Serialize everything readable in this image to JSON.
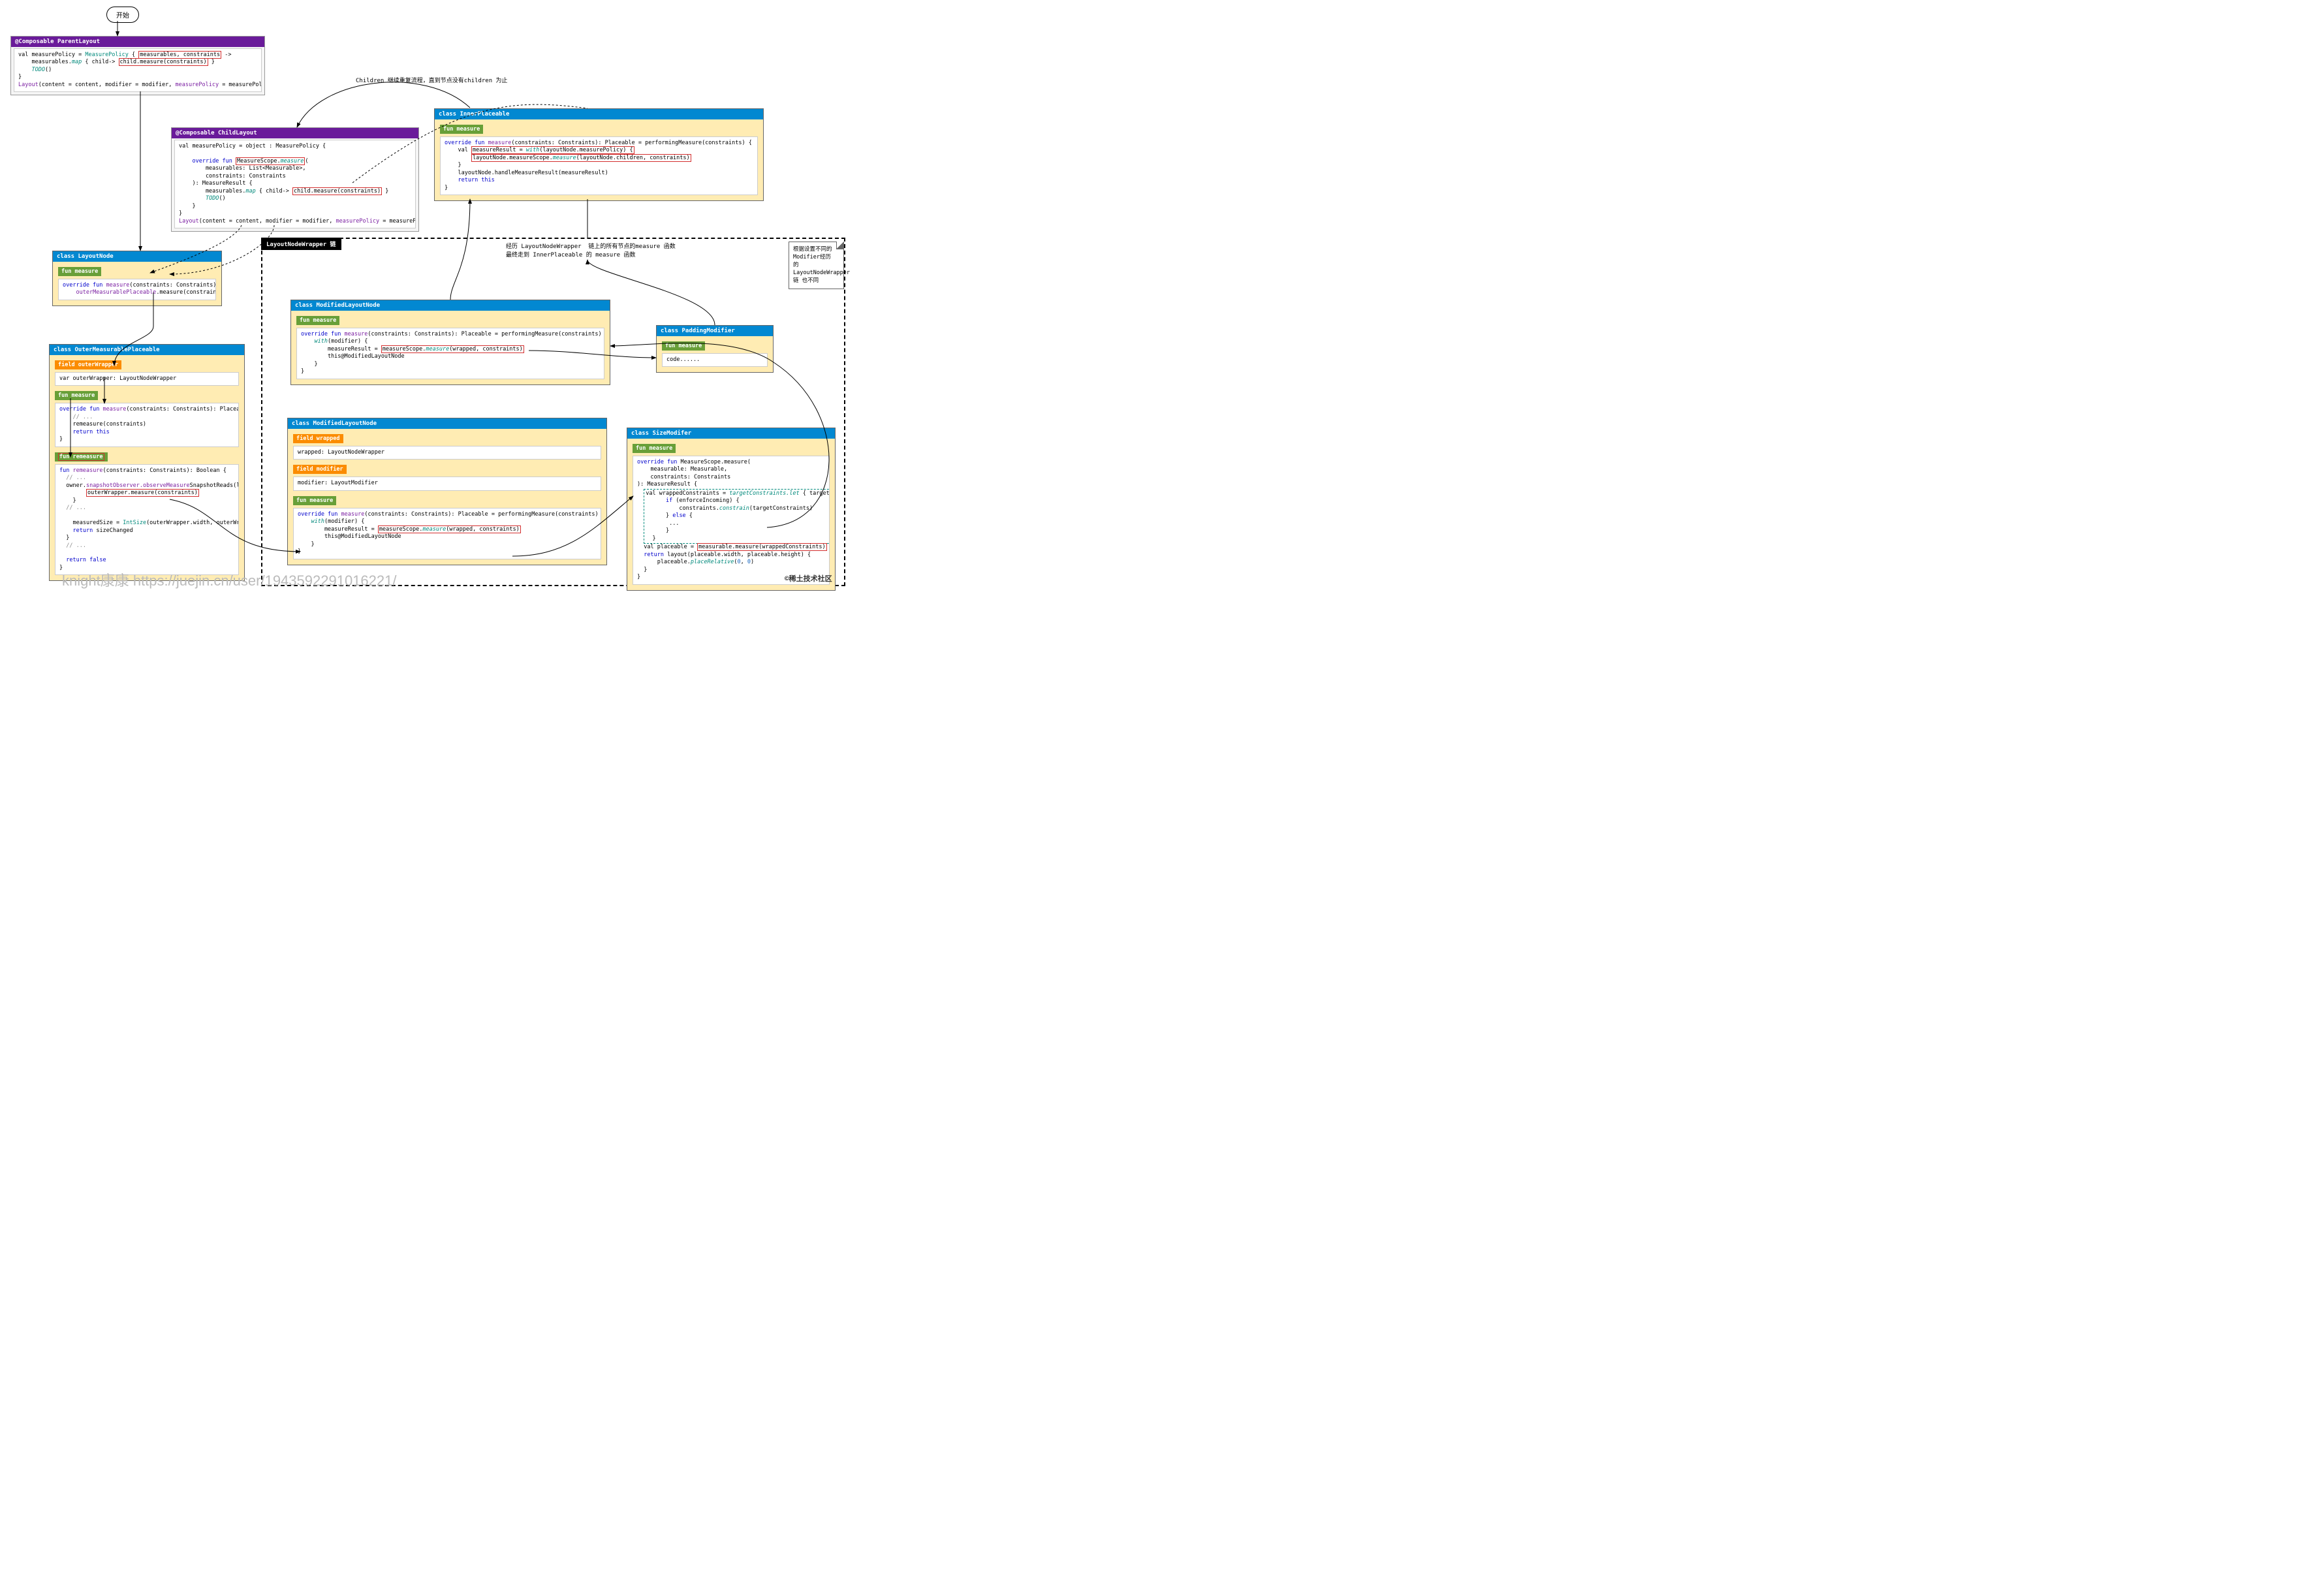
{
  "start": "开始",
  "parent": {
    "title": "@Composable ParentLayout",
    "code": "val measurePolicy = <span class='typ'>MeasurePolicy</span> { <span class='hl-red'>measurables, constraints</span> -&gt;\n    measurables.<span class='fnc'>map</span> { child-&gt; <span class='hl-red'>child.measure(constraints)</span> }\n    <span class='fnc'>TODO</span>()\n}\n<span class='fn'>Layout</span>(content = content, modifier = modifier, <span class='fn'>measurePolicy</span> = measurePolicy)"
  },
  "child": {
    "title": "@Composable ChildLayout",
    "code": "val measurePolicy = object : MeasurePolicy {\n\n    <span class='kw'>override fun</span> <span class='hl-red'>MeasureScope.<span class='fnc'>measure</span></span>(\n        measurables: List&lt;Measurable&gt;,\n        constraints: Constraints\n    ): MeasureResult {\n        measurables.<span class='fnc'>map</span> { child-&gt; <span class='hl-red'>child.measure(constraints)</span> }\n        <span class='fnc'>TODO</span>()\n    }\n}\n<span class='fn'>Layout</span>(content = content, modifier = modifier, <span class='fn'>measurePolicy</span> = measurePolicy)"
  },
  "annot_children": "Children 继续重复流程，直到节点没有children 为止",
  "inner": {
    "title": "class InnerPlaceable",
    "fun": "fun measure",
    "code": "<span class='kw'>override fun</span> <span class='fn'>measure</span>(constraints: Constraints): Placeable = performingMeasure(constraints) {\n    val <span class='hl-red'>measureResult = <span class='fnc'>with</span>(layoutNode.measurePolicy) {</span>\n        <span class='hl-red'>layoutNode.measureScope.<span class='fnc'>measure</span>(layoutNode.children, constraints)</span>\n    }\n    layoutNode.handleMeasureResult(measureResult)\n    <span class='kw'>return this</span>\n}"
  },
  "wrapper_chain_label": "LayoutNodeWrapper 链",
  "annot_chain": "经历 LayoutNodeWrapper  链上的所有节点的measure 函数\n最终走到 InnerPlaceable 的 measure 函数",
  "note": "根据设置不同的Modifier经历\n的LayoutNodeWrapper链\n也不同",
  "layoutnode": {
    "title": "class LayoutNode",
    "fun": "fun measure",
    "code": "<span class='kw'>override fun</span> <span class='fn'>measure</span>(constraints: Constraints) =\n    <span class='fn'>outerMeasurablePlaceable</span>.measure(constraints)"
  },
  "outer": {
    "title": "class OuterMeasurablePlaceable",
    "field": "field outerWrapper",
    "field_code": "var outerWrapper: LayoutNodeWrapper",
    "fun1": "fun measure",
    "fun1_code": "<span class='kw'>override fun</span> <span class='fn'>measure</span>(constraints: Constraints): Placeable {\n    <span class='cmt'>// ...</span>\n    remeasure(constraints)\n    <span class='kw'>return this</span>\n}",
    "fun2": "fun remeasure",
    "fun2_code": "<span class='kw'>fun</span> <span class='fn'>remeasure</span>(constraints: Constraints): Boolean {\n  <span class='cmt'>// ...</span>\n  owner.<span class='fn'>snapshotObserver.observeMeasure</span>SnapshotReads(layoutNode) {\n        <span class='hl-red'>outerWrapper.measure(constraints)</span>\n    }\n  <span class='cmt'>// ...</span>\n\n    measuredSize = <span class='typ'>IntSize</span>(outerWrapper.width, outerWrapper.height)\n    <span class='kw'>return</span> sizeChanged\n  }\n  <span class='cmt'>// ...</span>\n\n  <span class='kw'>return false</span>\n}"
  },
  "mod1": {
    "title": "class ModifiedLayoutNode",
    "fun": "fun measure",
    "code": "<span class='kw'>override fun</span> <span class='fn'>measure</span>(constraints: Constraints): Placeable = performingMeasure(constraints) {\n    <span class='fnc'>with</span>(modifier) {\n        measureResult = <span class='hl-red'>measureScope.<span class='fnc'>measure</span>(wrapped, constraints)</span>\n        this@ModifiedLayoutNode\n    }\n}"
  },
  "mod2": {
    "title": "class ModifiedLayoutNode",
    "f1": "field wrapped",
    "f1_code": "wrapped: LayoutNodeWrapper",
    "f2": "field modifier",
    "f2_code": "modifier: LayoutModifier",
    "fun": "fun measure",
    "code": "<span class='kw'>override fun</span> <span class='fn'>measure</span>(constraints: Constraints): Placeable = performingMeasure(constraints) {\n    <span class='fnc'>with</span>(modifier) {\n        measureResult = <span class='hl-red'>measureScope.<span class='fnc'>measure</span>(wrapped, constraints)</span>\n        this@ModifiedLayoutNode\n    }\n}"
  },
  "padding": {
    "title": "class PaddingModifier",
    "fun": "fun measure",
    "code": "code......"
  },
  "size": {
    "title": "class SizeModifer",
    "fun": "fun measure",
    "code": "<span class='kw'>override fun</span> MeasureScope.measure(\n    measurable: Measurable,\n    constraints: Constraints\n): MeasureResult {\n  <span class='hl-teal-dash'>val wrappedConstraints = <span class='fnc'>targetConstraints.let</span> { targetConstraints -&gt;\n      <span class='kw'>if</span> (enforceIncoming) {\n          constraints.<span class='fnc'>constrain</span>(targetConstraints)\n      } <span class='kw'>else</span> {\n       ...\n      }\n  }</span>\n  val placeable = <span class='hl-red'>measurable.measure(wrappedConstraints)</span>\n  <span class='kw'>return</span> layout(placeable.width, placeable.height) {\n      placeable.<span class='fnc'>placeRelative</span>(<span class='num'>0</span>, <span class='num'>0</span>)\n  }\n}"
  },
  "watermark": "knight康康 https://juejin.cn/user/1943592291016221/",
  "community": "©稀土技术社区"
}
